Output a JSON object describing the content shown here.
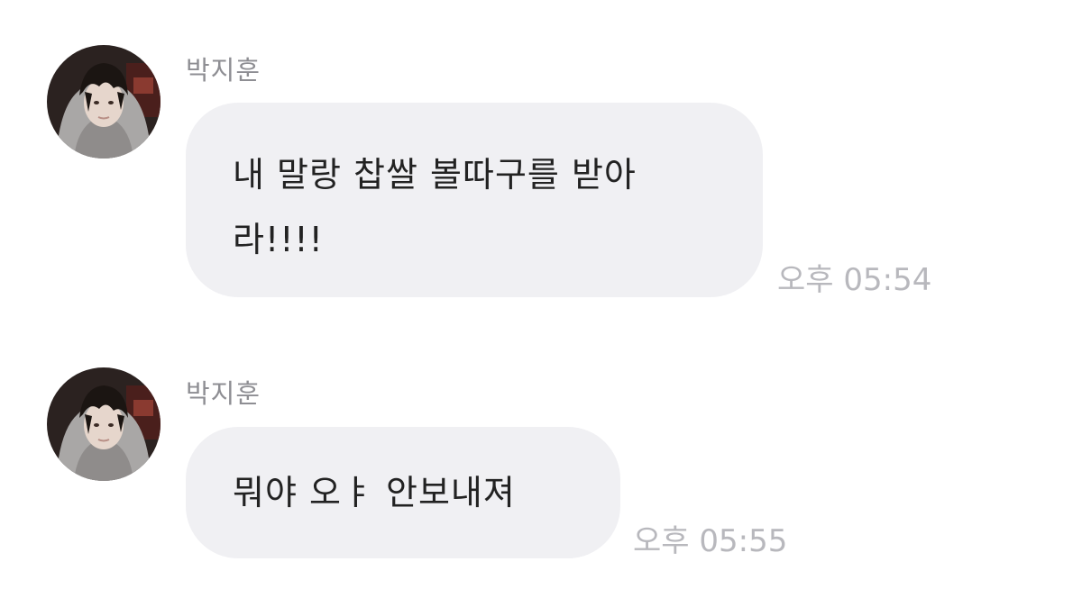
{
  "chat": {
    "messages": [
      {
        "sender": "박지훈",
        "text": "내 말랑 찹쌀 볼따구를 받아라!!!!",
        "time": "오후 05:54"
      },
      {
        "sender": "박지훈",
        "text": "뭐야 오ㅑ 안보내져",
        "time": "오후 05:55"
      }
    ]
  },
  "colors": {
    "background": "#ffffff",
    "bubble": "#f0f0f3",
    "message_text": "#222222",
    "sender_name": "#8e8e93",
    "timestamp": "#b8b8bd"
  },
  "icons": {
    "avatar": "profile-photo"
  }
}
